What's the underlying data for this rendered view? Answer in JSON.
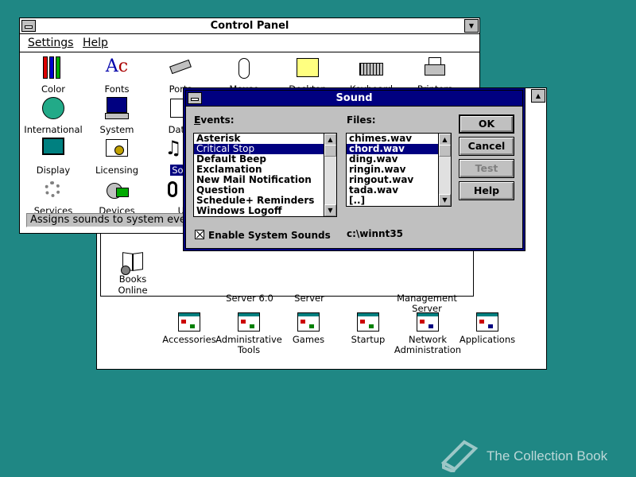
{
  "control_panel": {
    "title": "Control Panel",
    "menu": [
      "Settings",
      "Help"
    ],
    "icons": [
      {
        "label": "Color",
        "icon": "color-icon"
      },
      {
        "label": "Fonts",
        "icon": "fonts-icon"
      },
      {
        "label": "Ports",
        "icon": "ports-icon"
      },
      {
        "label": "Mouse",
        "icon": "mouse-icon"
      },
      {
        "label": "Desktop",
        "icon": "desktop-icon"
      },
      {
        "label": "Keyboard",
        "icon": "keyboard-icon"
      },
      {
        "label": "Printers",
        "icon": "printer-icon"
      },
      {
        "label": "International",
        "icon": "globe-icon"
      },
      {
        "label": "System",
        "icon": "system-icon"
      },
      {
        "label": "Date/",
        "icon": "date-time-icon"
      },
      {
        "label": "Display",
        "icon": "display-icon"
      },
      {
        "label": "Licensing",
        "icon": "licensing-icon"
      },
      {
        "label": "Sou",
        "icon": "sound-icon"
      },
      {
        "label": "Services",
        "icon": "services-icon"
      },
      {
        "label": "Devices",
        "icon": "devices-icon"
      },
      {
        "label": "UP",
        "icon": "ups-icon"
      }
    ],
    "status": "Assigns sounds to system event"
  },
  "program_manager": {
    "books_online": "Books Online",
    "partial_labels": [
      "Server 6.0",
      "Server",
      "Management",
      "Server"
    ],
    "groups": [
      "Accessories",
      "Administrative Tools",
      "Games",
      "Startup",
      "Network Administration",
      "Applications"
    ]
  },
  "sound_dialog": {
    "title": "Sound",
    "events_label": "Events:",
    "files_label": "Files:",
    "events": [
      "Asterisk",
      "Critical Stop",
      "Default Beep",
      "Exclamation",
      "New Mail Notification",
      "Question",
      "Schedule+ Reminders",
      "Windows Logoff"
    ],
    "selected_event": "Critical Stop",
    "files": [
      "chimes.wav",
      "chord.wav",
      "ding.wav",
      "ringin.wav",
      "ringout.wav",
      "tada.wav",
      "[..]"
    ],
    "selected_file": "chord.wav",
    "buttons": {
      "ok": "OK",
      "cancel": "Cancel",
      "test": "Test",
      "help": "Help"
    },
    "enable_label": "Enable System Sounds",
    "enable_checked": true,
    "path": "c:\\winnt35"
  },
  "watermark": "The Collection Book",
  "colors": {
    "desktop": "#1f8784",
    "title_active": "#000080",
    "selection": "#000080"
  }
}
